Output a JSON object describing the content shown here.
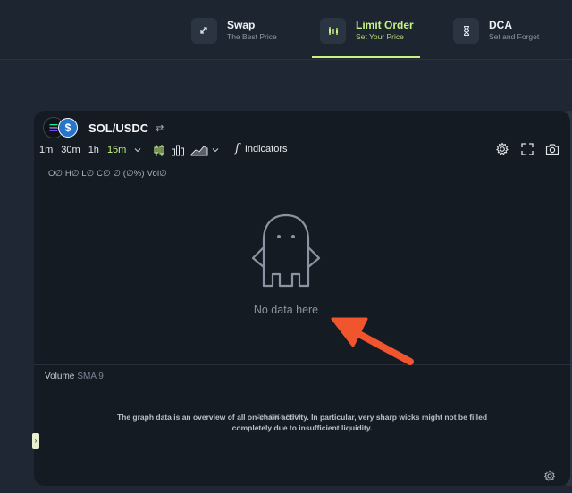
{
  "tabs": [
    {
      "title": "Swap",
      "subtitle": "The Best Price",
      "icon": "swap-arrows-icon",
      "active": false
    },
    {
      "title": "Limit Order",
      "subtitle": "Set Your Price",
      "icon": "limit-order-icon",
      "active": true
    },
    {
      "title": "DCA",
      "subtitle": "Set and Forget",
      "icon": "hourglass-icon",
      "active": false
    }
  ],
  "chart": {
    "pair": "SOL/USDC",
    "pair_switch": "⇄",
    "usdc_symbol": "$",
    "timeframes": [
      "1m",
      "30m",
      "1h",
      "15m"
    ],
    "selected_timeframe": "15m",
    "indicators_label": "Indicators",
    "indicators_fx": "f",
    "ohlc": "O∅ H∅ L∅ C∅ ∅ (∅%) Vol∅",
    "empty_text": "No data here",
    "volume_label": "Volume",
    "volume_sma": "SMA 9",
    "notice": "The graph data is an overview of all on-chain activity. In particular, very sharp wicks might not be filled completely due to insufficient liquidity.",
    "overlap_text": "No data here",
    "side_handle": "›"
  },
  "colors": {
    "accent": "#c7f284",
    "arrow": "#f0552e",
    "panel": "#151b23",
    "background": "#1e2733"
  }
}
